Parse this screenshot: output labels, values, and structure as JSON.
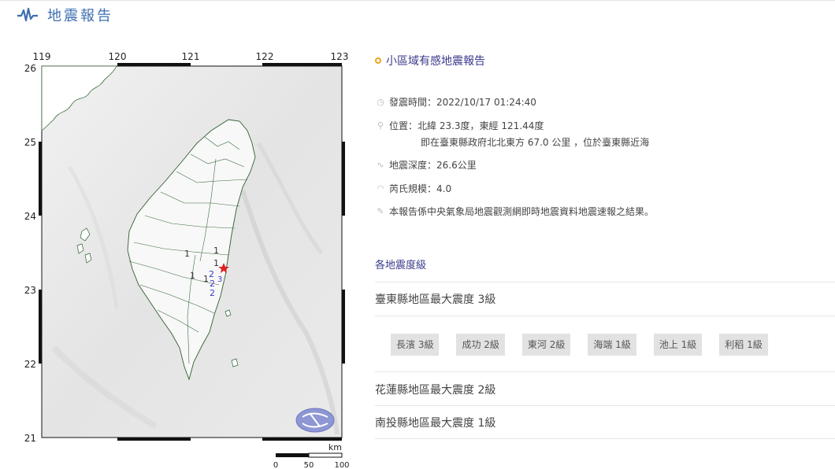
{
  "header": {
    "title": "地震報告",
    "icon": "seismograph-wave-icon"
  },
  "map": {
    "lon_labels": [
      "119",
      "120",
      "121",
      "122",
      "123"
    ],
    "lat_labels": [
      "26",
      "25",
      "24",
      "23",
      "22",
      "21"
    ],
    "scale": {
      "unit": "km",
      "labels": [
        "0",
        "50",
        "100"
      ]
    },
    "intensity_marks": [
      {
        "value": "1",
        "color": "#333333"
      },
      {
        "value": "1",
        "color": "#333333"
      },
      {
        "value": "1",
        "color": "#333333"
      },
      {
        "value": "1",
        "color": "#333333"
      },
      {
        "value": "1",
        "color": "#333333"
      },
      {
        "value": "2",
        "color": "#3a3acc"
      },
      {
        "value": "2",
        "color": "#3a3acc"
      },
      {
        "value": "3",
        "color": "#3a3acc"
      },
      {
        "value": "2",
        "color": "#3a3acc"
      }
    ],
    "epicenter_color": "#e02020",
    "logo": "cwb-logo"
  },
  "report": {
    "title": "小區域有感地震報告",
    "time_label": "發震時間：",
    "time": "2022/10/17 01:24:40",
    "location_label": "位置：",
    "location": "北緯 23.3度，東經 121.44度",
    "location_detail": "即在臺東縣政府北北東方 67.0 公里 ，位於臺東縣近海",
    "depth_label": "地震深度：",
    "depth": "26.6公里",
    "magnitude_label": "芮氏規模：",
    "magnitude": "4.0",
    "note": "本報告係中央氣象局地震觀測網即時地震資料地震速報之結果。",
    "icons": [
      "clock-icon",
      "location-pin-icon",
      "wave-icon",
      "rainbow-icon",
      "pen-icon"
    ]
  },
  "intensity": {
    "section_title": "各地震度級",
    "counties": [
      {
        "name": "臺東縣地區最大震度 3級",
        "stations": [
          "長濱 3級",
          "成功 2級",
          "東河 2級",
          "海端 1級",
          "池上 1級",
          "利稻 1級"
        ]
      },
      {
        "name": "花蓮縣地區最大震度 2級"
      },
      {
        "name": "南投縣地區最大震度 1級"
      }
    ]
  }
}
